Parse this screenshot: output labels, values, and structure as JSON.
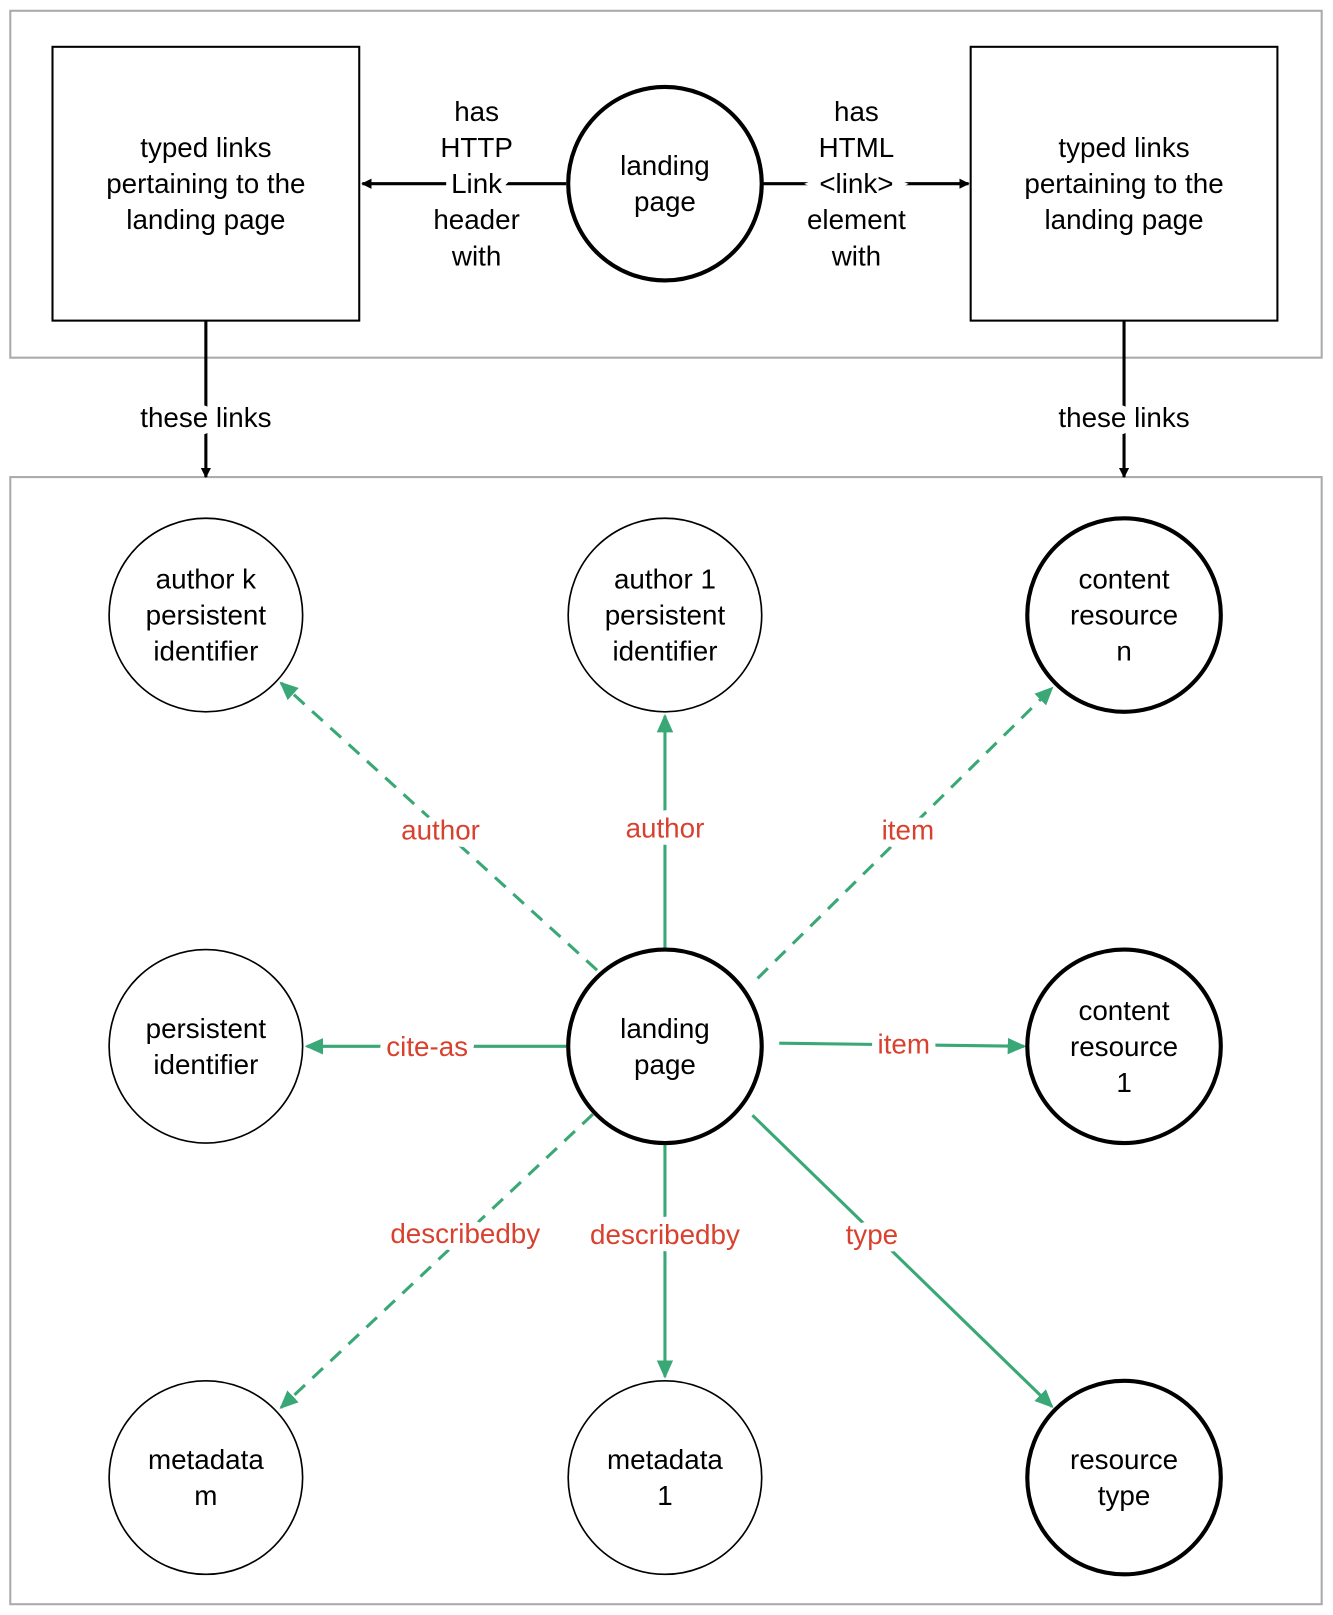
{
  "colors": {
    "edge": "#3aa876",
    "edge_label": "#d9412f",
    "frame": "#aaaaaa",
    "node_stroke": "#000000"
  },
  "top": {
    "center_node": [
      "landing",
      "page"
    ],
    "left_box": [
      "typed links",
      "pertaining to the",
      "landing page"
    ],
    "right_box": [
      "typed links",
      "pertaining to the",
      "landing page"
    ],
    "left_edge_label": [
      "has",
      "HTTP",
      "Link",
      "header",
      "with"
    ],
    "right_edge_label": [
      "has",
      "HTML",
      "<link>",
      "element",
      "with"
    ],
    "left_down_label": "these links",
    "right_down_label": "these links"
  },
  "nodes": {
    "author_k": [
      "author k",
      "persistent",
      "identifier"
    ],
    "author_1": [
      "author 1",
      "persistent",
      "identifier"
    ],
    "content_n": [
      "content",
      "resource",
      "n"
    ],
    "persistent_id": [
      "persistent",
      "identifier"
    ],
    "landing": [
      "landing",
      "page"
    ],
    "content_1": [
      "content",
      "resource",
      "1"
    ],
    "metadata_m": [
      "metadata",
      "m"
    ],
    "metadata_1": [
      "metadata",
      "1"
    ],
    "resource_type": [
      "resource",
      "type"
    ]
  },
  "edges": [
    {
      "to": "author_k",
      "label": "author",
      "style": "dashed"
    },
    {
      "to": "author_1",
      "label": "author",
      "style": "solid"
    },
    {
      "to": "content_n",
      "label": "item",
      "style": "dashed"
    },
    {
      "to": "persistent_id",
      "label": "cite-as",
      "style": "solid"
    },
    {
      "to": "content_1",
      "label": "item",
      "style": "solid"
    },
    {
      "to": "metadata_m",
      "label": "describedby",
      "style": "dashed"
    },
    {
      "to": "metadata_1",
      "label": "describedby",
      "style": "solid"
    },
    {
      "to": "resource_type",
      "label": "type",
      "style": "solid"
    }
  ]
}
